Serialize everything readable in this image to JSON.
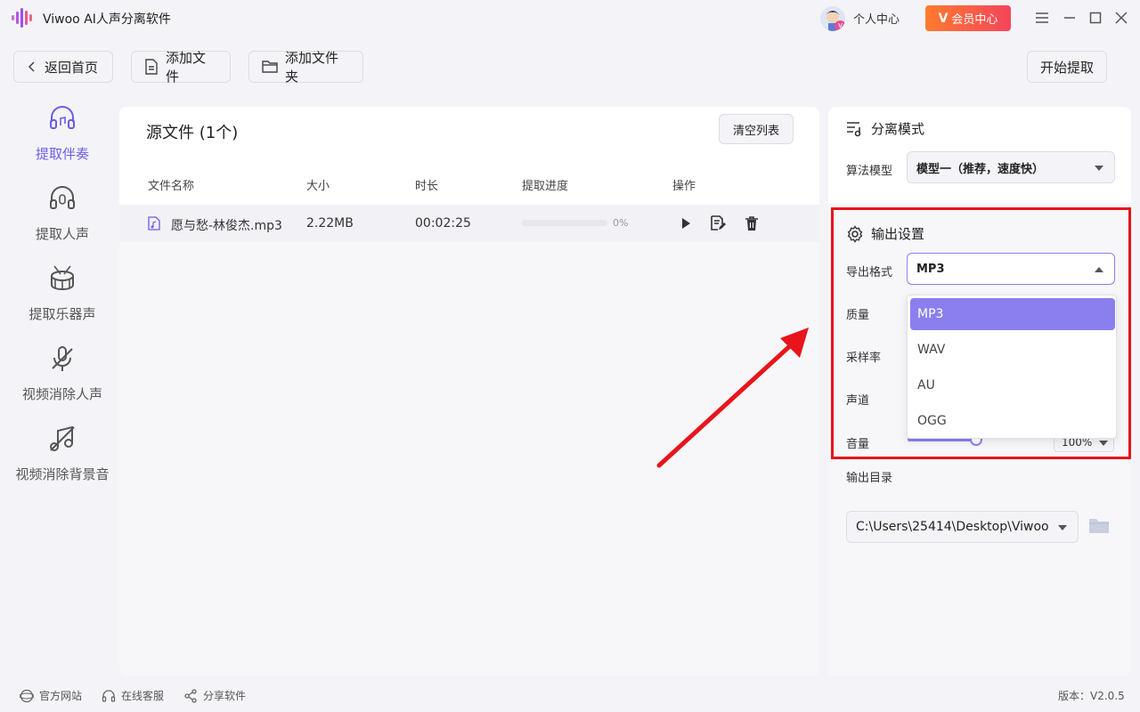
{
  "window": {
    "title": "Viwoo AI人声分离软件",
    "personal_center": "个人中心",
    "vip_center": "会员中心",
    "vip_mark": "V"
  },
  "toolbar": {
    "back": "返回首页",
    "add_file": "添加文件",
    "add_folder": "添加文件夹",
    "start": "开始提取"
  },
  "sidebar": {
    "items": [
      {
        "label": "提取伴奏",
        "icon": "headphones-music-icon",
        "active": true
      },
      {
        "label": "提取人声",
        "icon": "headset-mic-icon",
        "active": false
      },
      {
        "label": "提取乐器声",
        "icon": "drum-icon",
        "active": false
      },
      {
        "label": "视频消除人声",
        "icon": "mic-off-icon",
        "active": false
      },
      {
        "label": "视频消除背景音",
        "icon": "music-off-icon",
        "active": false
      }
    ]
  },
  "files": {
    "title": "源文件 (1个)",
    "clear_label": "清空列表",
    "columns": [
      "文件名称",
      "大小",
      "时长",
      "提取进度",
      "操作"
    ],
    "rows": [
      {
        "name": "愿与愁-林俊杰.mp3",
        "size": "2.22MB",
        "duration": "00:02:25",
        "progress_label": "0%",
        "progress": 0
      }
    ]
  },
  "separation": {
    "title": "分离模式",
    "model_label": "算法模型",
    "model_value": "模型一（推荐，速度快）"
  },
  "output": {
    "title": "输出设置",
    "format_label": "导出格式",
    "format_value": "MP3",
    "quality_label": "质量",
    "sample_rate_label": "采样率",
    "channel_label": "声道",
    "volume_label": "音量",
    "volume_value": "100%",
    "volume_level": 1.0,
    "dir_label": "输出目录",
    "dir_value": "C:\\Users\\25414\\Desktop\\Viwoo",
    "format_options": [
      "MP3",
      "WAV",
      "AU",
      "OGG"
    ],
    "selected_option": "MP3"
  },
  "footer": {
    "website": "官方网站",
    "support": "在线客服",
    "share": "分享软件",
    "version": "版本：V2.0.5"
  },
  "colors": {
    "accent": "#8b7ff0",
    "highlight_box": "#e8141b",
    "vip_gradient_start": "#ff7a2e",
    "vip_gradient_end": "#f5455c"
  }
}
